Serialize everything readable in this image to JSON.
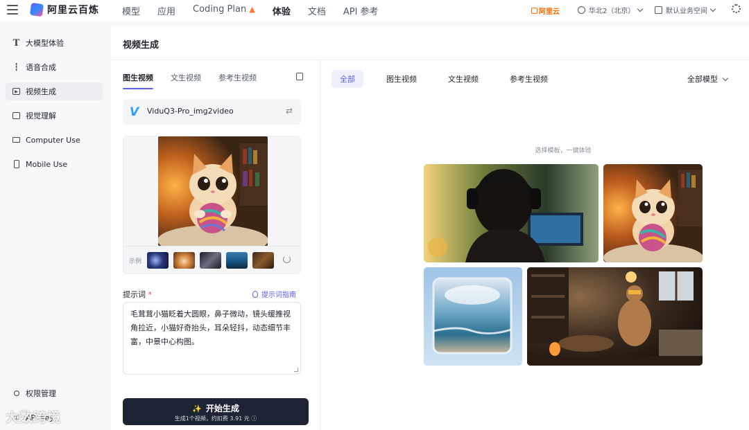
{
  "topbar": {
    "logo_text": "阿里云百炼",
    "nav": [
      "模型",
      "应用",
      "Coding Plan",
      "体验",
      "文档",
      "API 参考"
    ],
    "nav_active": "体验",
    "aliyun_badge": "阿里云",
    "region": "华北2（北京）",
    "workspace": "默认业务空间"
  },
  "sidebar": {
    "items": [
      {
        "label": "大模型体验",
        "icon": "text-t-icon"
      },
      {
        "label": "语音合成",
        "icon": "audio-wave-icon"
      },
      {
        "label": "视频生成",
        "icon": "video-icon"
      },
      {
        "label": "视觉理解",
        "icon": "image-icon"
      },
      {
        "label": "Computer Use",
        "icon": "monitor-icon"
      },
      {
        "label": "Mobile Use",
        "icon": "phone-icon"
      }
    ],
    "active_index": 2,
    "bottom_items": [
      {
        "label": "权限管理",
        "icon": "user-icon"
      },
      {
        "label": "API Key",
        "icon": "key-icon"
      }
    ]
  },
  "page": {
    "title": "视频生成"
  },
  "left_panel": {
    "tabs": [
      "图生视频",
      "文生视频",
      "参考生视频"
    ],
    "active_tab": "图生视频",
    "model_name": "ViduQ3-Pro_img2video",
    "examples_label": "示例",
    "prompt_label": "提示词",
    "prompt_required_mark": "*",
    "prompt_guide": "提示词指南",
    "prompt_text": "毛茸茸小猫眨着大圆眼，鼻子微动，镜头缓推视角拉近，小猫好奇抬头，耳朵轻抖，动态细节丰富，中景中心构图。",
    "generate_label": "开始生成",
    "generate_sub": "生成1个视频，约扣费 3.91 元 ⓘ"
  },
  "right_panel": {
    "filters": [
      "全部",
      "图生视频",
      "文生视频",
      "参考生视频"
    ],
    "active_filter": "全部",
    "model_filter": "全部模型",
    "hint": "选择模板，一键体验"
  },
  "watermark": "大数跨境",
  "colors": {
    "accent": "#5b5cf6",
    "button_dark": "#1d2433",
    "brand_orange": "#ff6a00"
  }
}
